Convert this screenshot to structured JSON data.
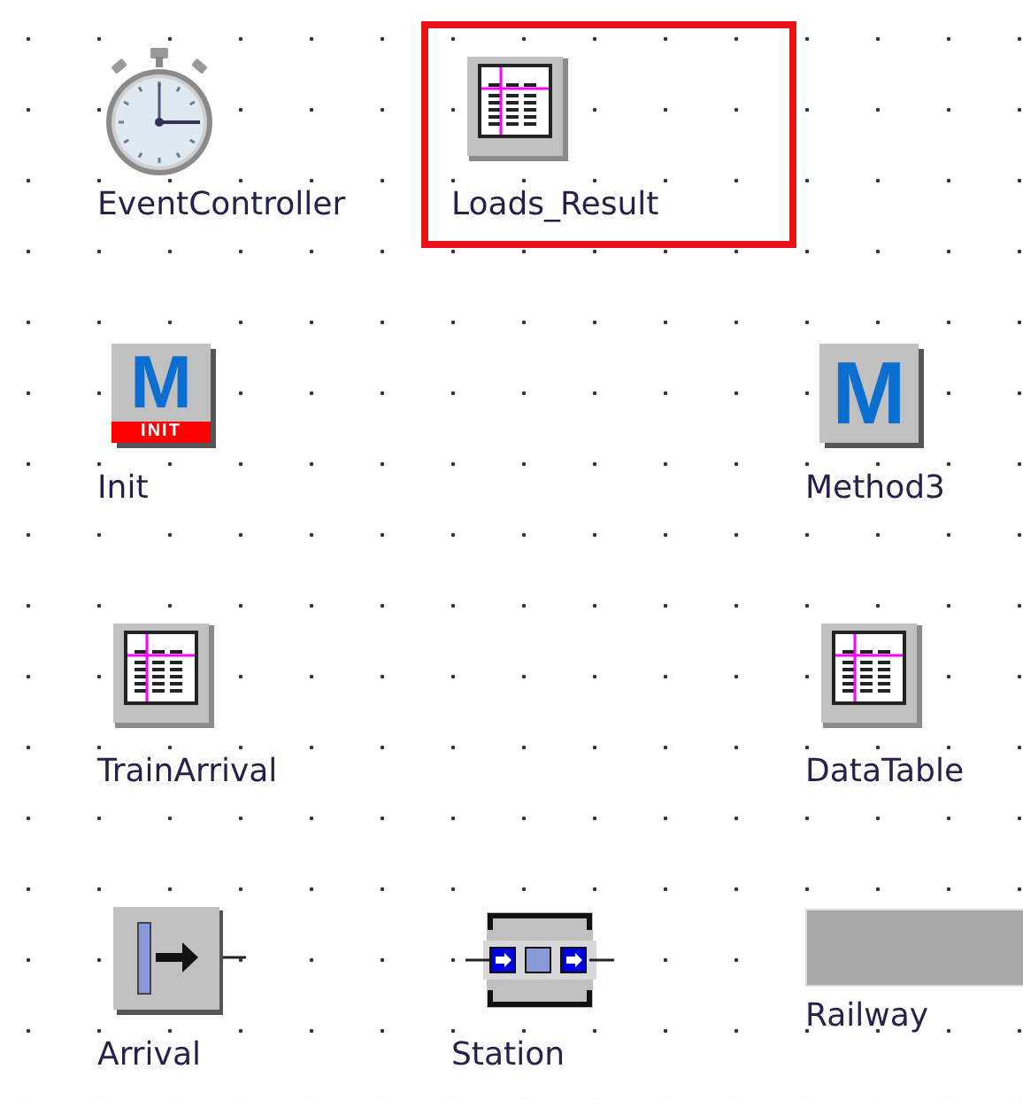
{
  "objects": [
    {
      "kind": "event_controller",
      "label": "EventController",
      "selected": false
    },
    {
      "kind": "table",
      "label": "Loads_Result",
      "selected": true
    },
    {
      "kind": "method",
      "label": "Init",
      "icon_text": "M",
      "badge": "INIT",
      "selected": false
    },
    {
      "kind": "method",
      "label": "Method3",
      "icon_text": "M",
      "selected": false
    },
    {
      "kind": "table",
      "label": "TrainArrival",
      "selected": false
    },
    {
      "kind": "table",
      "label": "DataTable",
      "selected": false
    },
    {
      "kind": "source",
      "label": "Arrival",
      "selected": false
    },
    {
      "kind": "station",
      "label": "Station",
      "selected": false
    },
    {
      "kind": "track",
      "label": "Railway",
      "selected": false
    }
  ]
}
